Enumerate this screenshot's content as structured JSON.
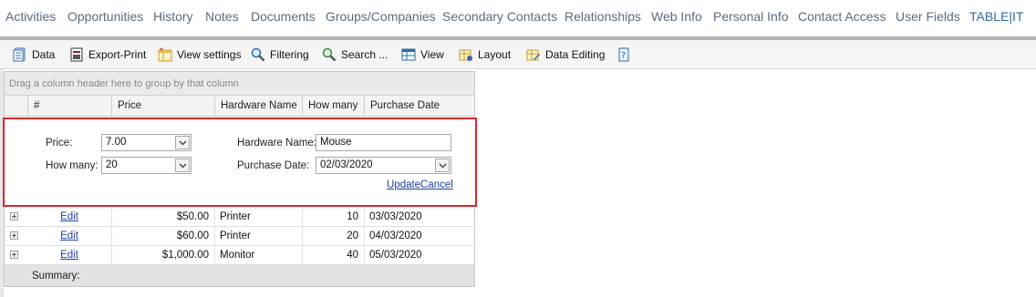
{
  "nav": {
    "items": [
      "Activities",
      "Opportunities",
      "History",
      "Notes",
      "Documents",
      "Groups/Companies",
      "Secondary Contacts",
      "Relationships",
      "Web Info",
      "Personal Info",
      "Contact Access",
      "User Fields",
      "TABLE|IT"
    ]
  },
  "toolbar": {
    "data": "Data",
    "export_print": "Export-Print",
    "view_settings": "View settings",
    "filtering": "Filtering",
    "search": "Search ...",
    "view": "View",
    "layout": "Layout",
    "data_editing": "Data Editing"
  },
  "grid": {
    "group_panel": "Drag a column header here to group by that column",
    "columns": [
      "#",
      "Price",
      "Hardware Name",
      "How many",
      "Purchase Date"
    ],
    "edit_form": {
      "price_label": "Price:",
      "price_value": "7.00",
      "how_many_label": "How many:",
      "how_many_value": "20",
      "hardware_label": "Hardware Name:",
      "hardware_value": "Mouse",
      "date_label": "Purchase Date:",
      "date_value": "02/03/2020",
      "update": "Update",
      "cancel": "Cancel"
    },
    "rows": [
      {
        "edit": "Edit",
        "price": "$50.00",
        "hardware": "Printer",
        "qty": "10",
        "date": "03/03/2020"
      },
      {
        "edit": "Edit",
        "price": "$60.00",
        "hardware": "Printer",
        "qty": "20",
        "date": "04/03/2020"
      },
      {
        "edit": "Edit",
        "price": "$1,000.00",
        "hardware": "Monitor",
        "qty": "40",
        "date": "05/03/2020"
      }
    ],
    "summary": "Summary:"
  }
}
